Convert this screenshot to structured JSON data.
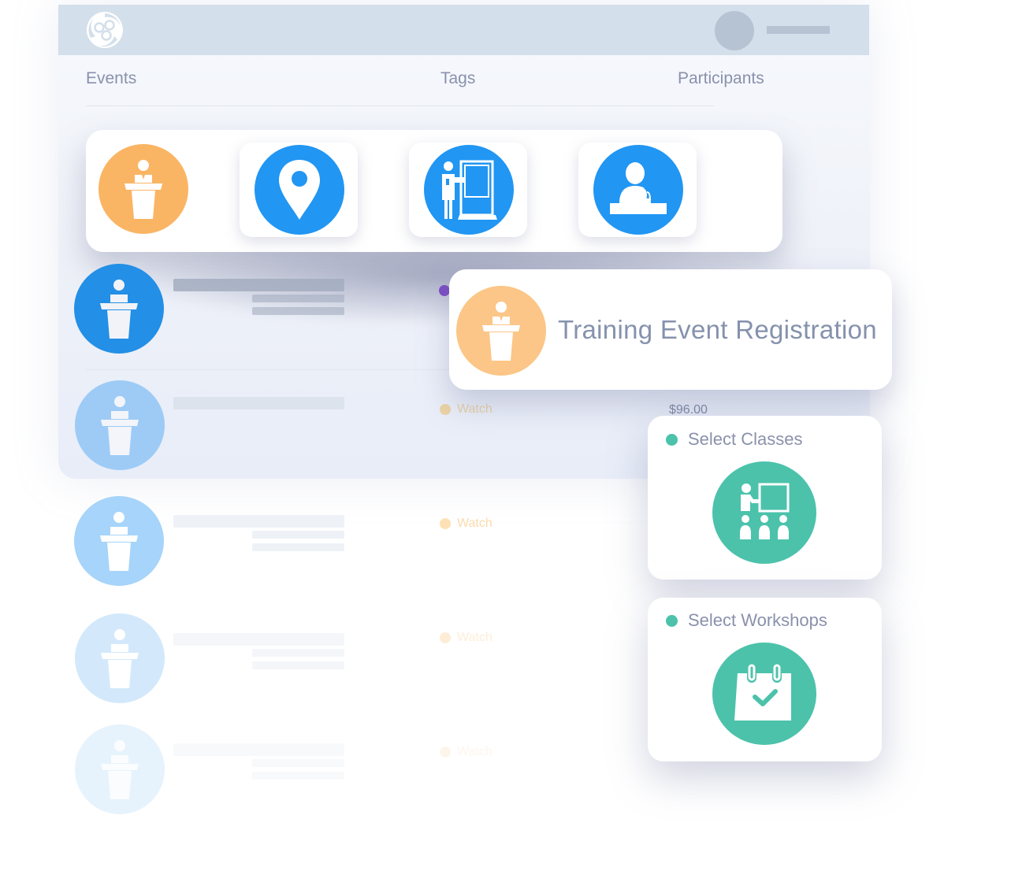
{
  "header": {
    "logo_icon": "app-logo-icon",
    "avatar_icon": "user-avatar",
    "colors": {
      "topbar": "#d3dfea",
      "placeholder": "#b5c3d3"
    }
  },
  "table": {
    "columns": [
      "Events",
      "Tags",
      "Participants"
    ]
  },
  "icon_panel": {
    "icons": [
      {
        "name": "speaker-podium-icon",
        "color": "#fab564"
      },
      {
        "name": "location-pin-icon",
        "color": "#2196f3"
      },
      {
        "name": "presenter-board-icon",
        "color": "#2196f3"
      },
      {
        "name": "person-at-desk-icon",
        "color": "#2196f3"
      }
    ]
  },
  "rows": [
    {
      "icon": "speaker-podium-icon",
      "tag": "",
      "price": ""
    },
    {
      "icon": "speaker-podium-icon",
      "tag": "Watch",
      "price": "$96.00"
    },
    {
      "icon": "speaker-podium-icon",
      "tag": "Watch",
      "price": ""
    },
    {
      "icon": "speaker-podium-icon",
      "tag": "Watch",
      "price": ""
    },
    {
      "icon": "speaker-podium-icon",
      "tag": "Watch",
      "price": ""
    }
  ],
  "registration_card": {
    "title": "Training Event Registration",
    "icon": "speaker-podium-icon",
    "color": "#fbc687"
  },
  "select_cards": [
    {
      "label": "Select Classes",
      "icon": "classroom-icon",
      "color": "#4cc2ab"
    },
    {
      "label": "Select Workshops",
      "icon": "calendar-check-icon",
      "color": "#4cc2ab"
    }
  ]
}
